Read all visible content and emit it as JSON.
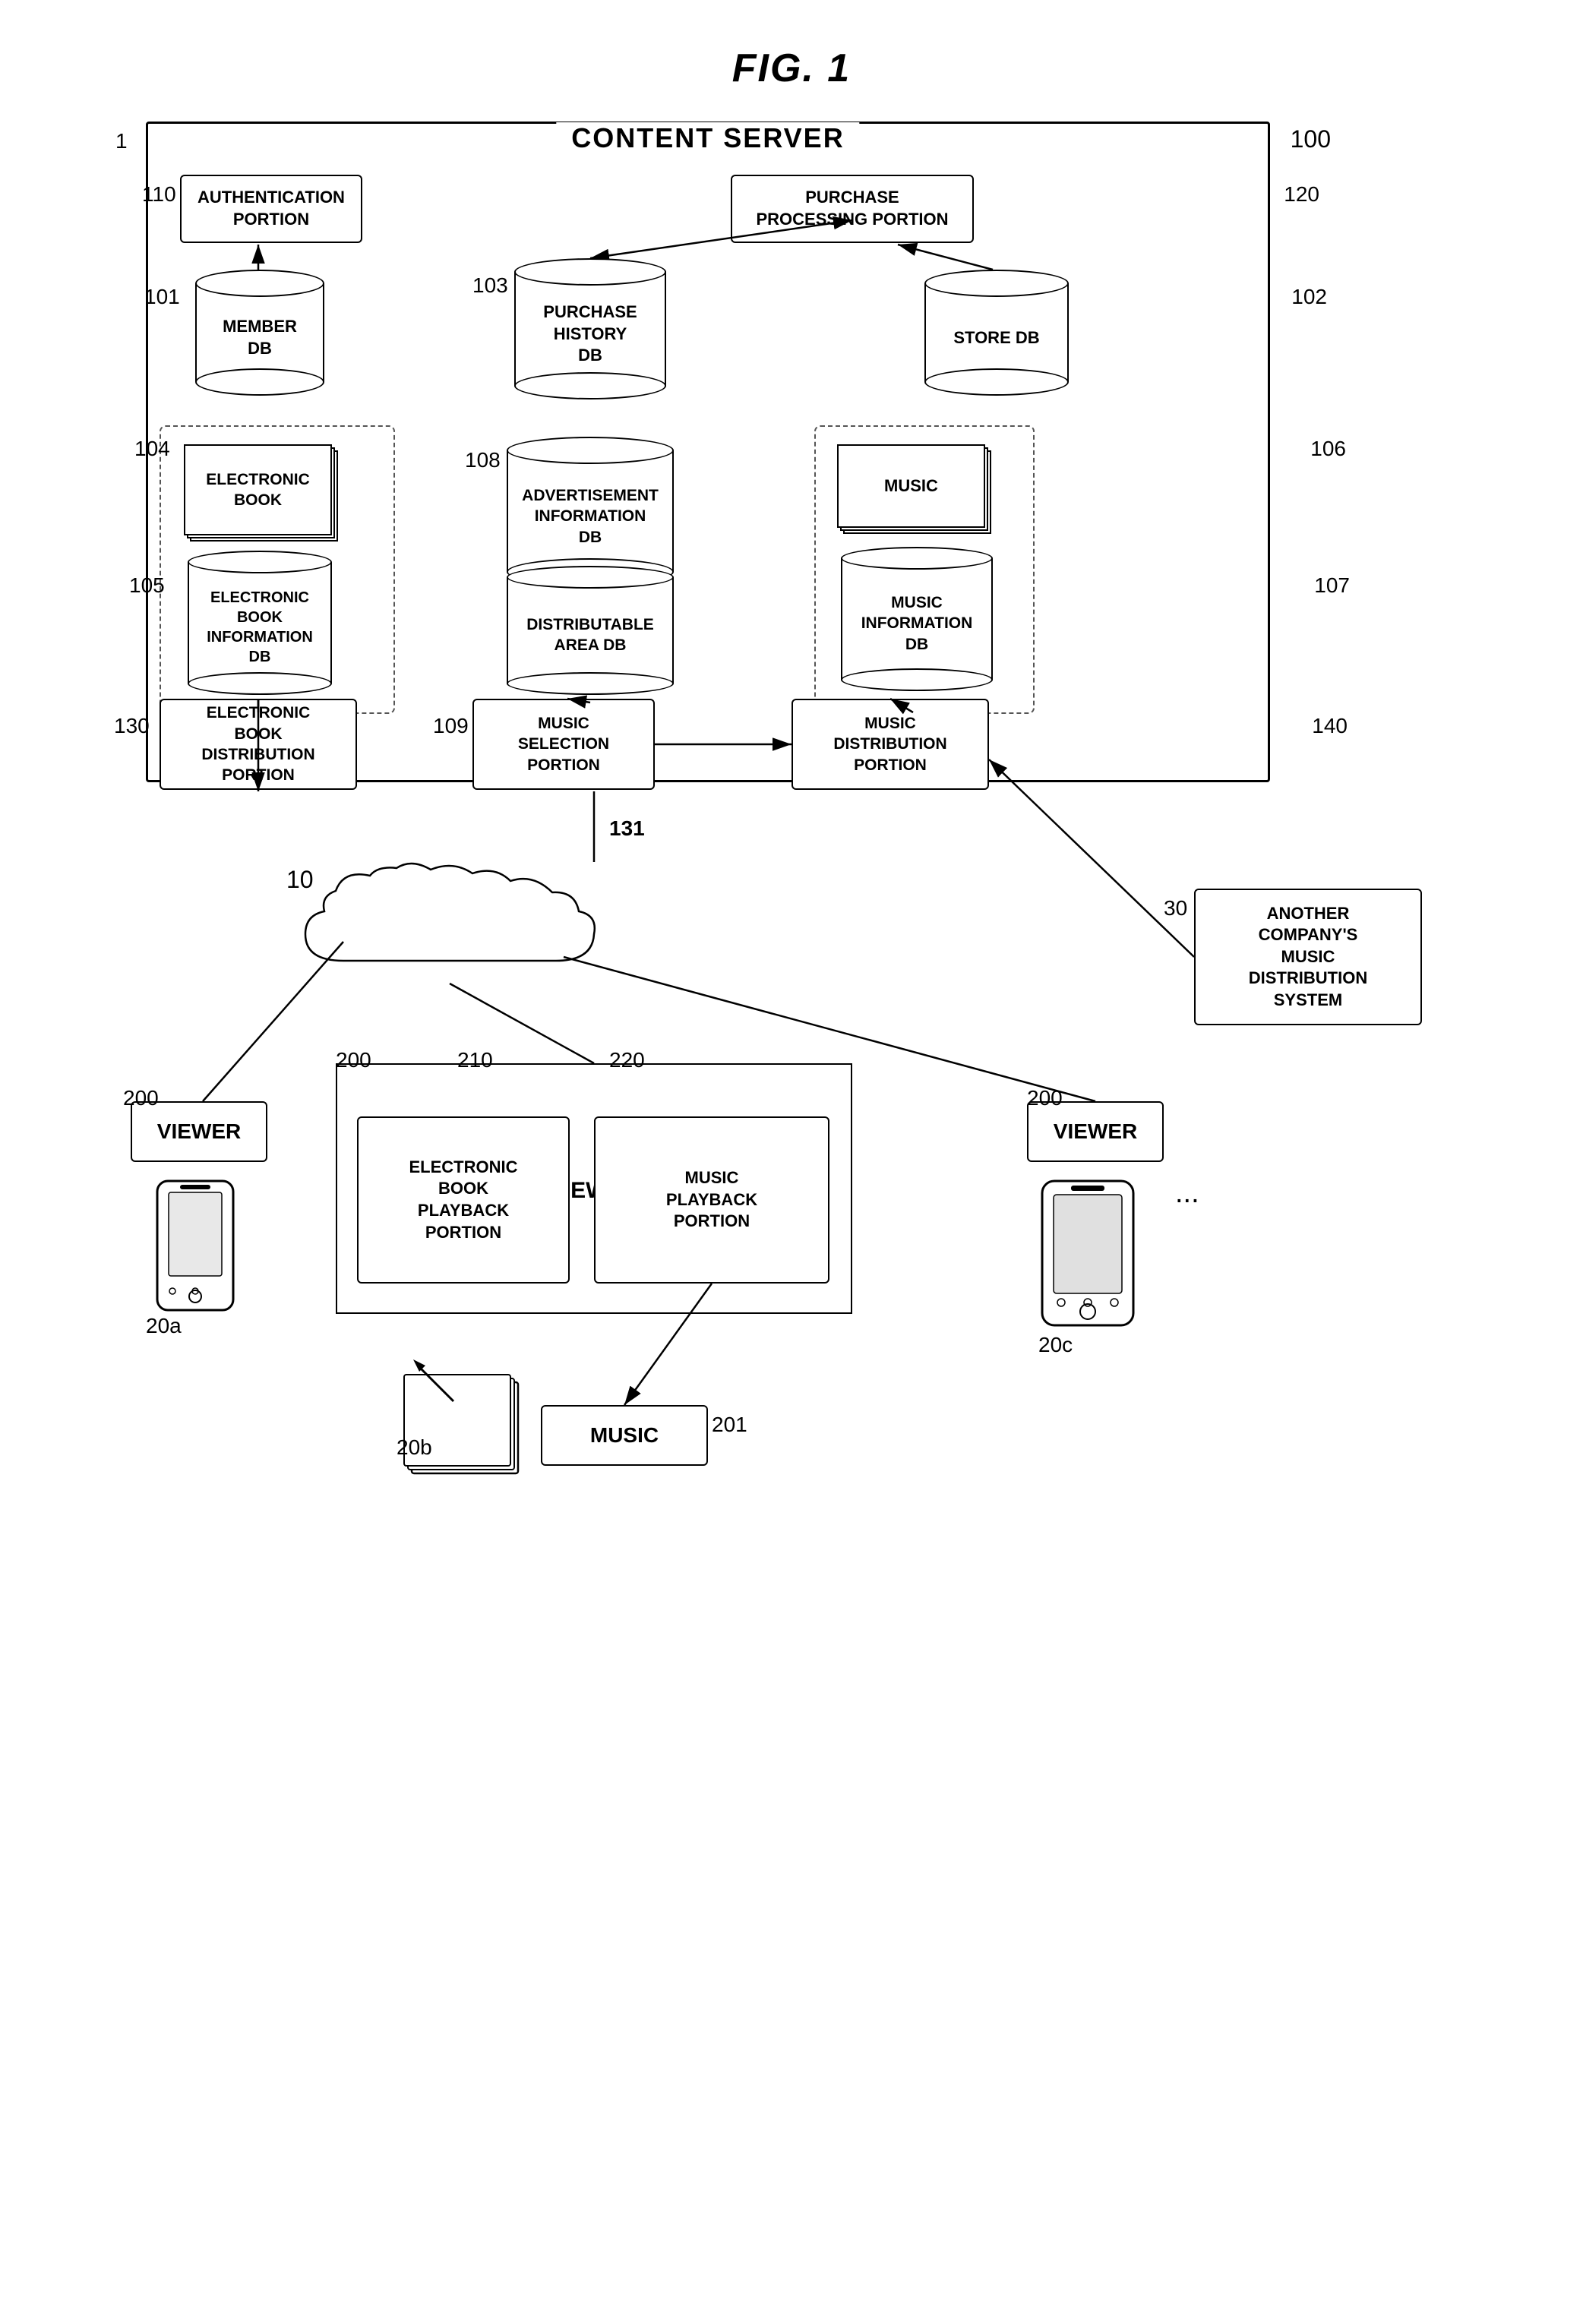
{
  "title": "FIG. 1",
  "diagram": {
    "content_server_label": "CONTENT SERVER",
    "ref_1": "1",
    "ref_100": "100",
    "ref_10": "10",
    "ref_30": "30",
    "ref_101": "101",
    "ref_102": "102",
    "ref_103": "103",
    "ref_104": "104",
    "ref_105": "105",
    "ref_106": "106",
    "ref_107": "107",
    "ref_108": "108",
    "ref_109": "109",
    "ref_110": "110",
    "ref_120": "120",
    "ref_130": "130",
    "ref_131": "131",
    "ref_140": "140",
    "ref_200a": "200",
    "ref_200b": "200",
    "ref_200c": "200",
    "ref_201": "201",
    "ref_210": "210",
    "ref_220": "220",
    "ref_20a": "20a",
    "ref_20b": "20b",
    "ref_20c": "20c",
    "authentication_portion": "AUTHENTICATION\nPORTION",
    "purchase_processing_portion": "PURCHASE\nPROCESSING PORTION",
    "member_db": "MEMBER\nDB",
    "purchase_history_db": "PURCHASE\nHISTORY\nDB",
    "store_db": "STORE DB",
    "electronic_book": "ELECTRONIC\nBOOK",
    "electronic_book_info_db": "ELECTRONIC\nBOOK\nINFORMATION\nDB",
    "advertisement_info_db": "ADVERTISEMENT\nINFORMATION\nDB",
    "distributable_area_db": "DISTRIBUTABLE\nAREA DB",
    "music": "MUSIC",
    "music_info_db": "MUSIC\nINFORMATION\nDB",
    "electronic_book_distribution": "ELECTRONIC\nBOOK\nDISTRIBUTION\nPORTION",
    "music_selection": "MUSIC\nSELECTION\nPORTION",
    "music_distribution": "MUSIC\nDISTRIBUTION\nPORTION",
    "viewer_label": "VIEWER",
    "electronic_book_playback": "ELECTRONIC\nBOOK\nPLAYBACK\nPORTION",
    "music_playback": "MUSIC\nPLAYBACK\nPORTION",
    "viewer_left_label": "VIEWER",
    "viewer_right_label": "VIEWER",
    "music_label": "MUSIC",
    "another_company": "ANOTHER\nCOMPANY'S\nMUSIC\nDISTRIBUTION\nSYSTEM",
    "dotdotdot": "..."
  }
}
